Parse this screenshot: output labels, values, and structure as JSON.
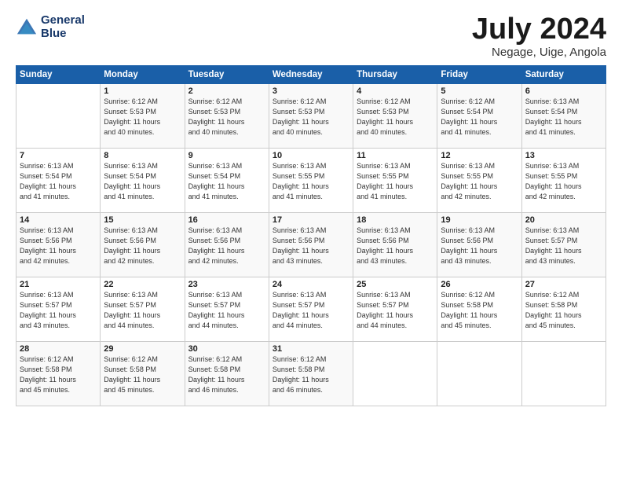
{
  "header": {
    "logo_line1": "General",
    "logo_line2": "Blue",
    "title": "July 2024",
    "location": "Negage, Uige, Angola"
  },
  "days_of_week": [
    "Sunday",
    "Monday",
    "Tuesday",
    "Wednesday",
    "Thursday",
    "Friday",
    "Saturday"
  ],
  "weeks": [
    [
      {
        "day": "",
        "info": ""
      },
      {
        "day": "1",
        "info": "Sunrise: 6:12 AM\nSunset: 5:53 PM\nDaylight: 11 hours\nand 40 minutes."
      },
      {
        "day": "2",
        "info": "Sunrise: 6:12 AM\nSunset: 5:53 PM\nDaylight: 11 hours\nand 40 minutes."
      },
      {
        "day": "3",
        "info": "Sunrise: 6:12 AM\nSunset: 5:53 PM\nDaylight: 11 hours\nand 40 minutes."
      },
      {
        "day": "4",
        "info": "Sunrise: 6:12 AM\nSunset: 5:53 PM\nDaylight: 11 hours\nand 40 minutes."
      },
      {
        "day": "5",
        "info": "Sunrise: 6:12 AM\nSunset: 5:54 PM\nDaylight: 11 hours\nand 41 minutes."
      },
      {
        "day": "6",
        "info": "Sunrise: 6:13 AM\nSunset: 5:54 PM\nDaylight: 11 hours\nand 41 minutes."
      }
    ],
    [
      {
        "day": "7",
        "info": "Sunrise: 6:13 AM\nSunset: 5:54 PM\nDaylight: 11 hours\nand 41 minutes."
      },
      {
        "day": "8",
        "info": "Sunrise: 6:13 AM\nSunset: 5:54 PM\nDaylight: 11 hours\nand 41 minutes."
      },
      {
        "day": "9",
        "info": "Sunrise: 6:13 AM\nSunset: 5:54 PM\nDaylight: 11 hours\nand 41 minutes."
      },
      {
        "day": "10",
        "info": "Sunrise: 6:13 AM\nSunset: 5:55 PM\nDaylight: 11 hours\nand 41 minutes."
      },
      {
        "day": "11",
        "info": "Sunrise: 6:13 AM\nSunset: 5:55 PM\nDaylight: 11 hours\nand 41 minutes."
      },
      {
        "day": "12",
        "info": "Sunrise: 6:13 AM\nSunset: 5:55 PM\nDaylight: 11 hours\nand 42 minutes."
      },
      {
        "day": "13",
        "info": "Sunrise: 6:13 AM\nSunset: 5:55 PM\nDaylight: 11 hours\nand 42 minutes."
      }
    ],
    [
      {
        "day": "14",
        "info": "Sunrise: 6:13 AM\nSunset: 5:56 PM\nDaylight: 11 hours\nand 42 minutes."
      },
      {
        "day": "15",
        "info": "Sunrise: 6:13 AM\nSunset: 5:56 PM\nDaylight: 11 hours\nand 42 minutes."
      },
      {
        "day": "16",
        "info": "Sunrise: 6:13 AM\nSunset: 5:56 PM\nDaylight: 11 hours\nand 42 minutes."
      },
      {
        "day": "17",
        "info": "Sunrise: 6:13 AM\nSunset: 5:56 PM\nDaylight: 11 hours\nand 43 minutes."
      },
      {
        "day": "18",
        "info": "Sunrise: 6:13 AM\nSunset: 5:56 PM\nDaylight: 11 hours\nand 43 minutes."
      },
      {
        "day": "19",
        "info": "Sunrise: 6:13 AM\nSunset: 5:56 PM\nDaylight: 11 hours\nand 43 minutes."
      },
      {
        "day": "20",
        "info": "Sunrise: 6:13 AM\nSunset: 5:57 PM\nDaylight: 11 hours\nand 43 minutes."
      }
    ],
    [
      {
        "day": "21",
        "info": "Sunrise: 6:13 AM\nSunset: 5:57 PM\nDaylight: 11 hours\nand 43 minutes."
      },
      {
        "day": "22",
        "info": "Sunrise: 6:13 AM\nSunset: 5:57 PM\nDaylight: 11 hours\nand 44 minutes."
      },
      {
        "day": "23",
        "info": "Sunrise: 6:13 AM\nSunset: 5:57 PM\nDaylight: 11 hours\nand 44 minutes."
      },
      {
        "day": "24",
        "info": "Sunrise: 6:13 AM\nSunset: 5:57 PM\nDaylight: 11 hours\nand 44 minutes."
      },
      {
        "day": "25",
        "info": "Sunrise: 6:13 AM\nSunset: 5:57 PM\nDaylight: 11 hours\nand 44 minutes."
      },
      {
        "day": "26",
        "info": "Sunrise: 6:12 AM\nSunset: 5:58 PM\nDaylight: 11 hours\nand 45 minutes."
      },
      {
        "day": "27",
        "info": "Sunrise: 6:12 AM\nSunset: 5:58 PM\nDaylight: 11 hours\nand 45 minutes."
      }
    ],
    [
      {
        "day": "28",
        "info": "Sunrise: 6:12 AM\nSunset: 5:58 PM\nDaylight: 11 hours\nand 45 minutes."
      },
      {
        "day": "29",
        "info": "Sunrise: 6:12 AM\nSunset: 5:58 PM\nDaylight: 11 hours\nand 45 minutes."
      },
      {
        "day": "30",
        "info": "Sunrise: 6:12 AM\nSunset: 5:58 PM\nDaylight: 11 hours\nand 46 minutes."
      },
      {
        "day": "31",
        "info": "Sunrise: 6:12 AM\nSunset: 5:58 PM\nDaylight: 11 hours\nand 46 minutes."
      },
      {
        "day": "",
        "info": ""
      },
      {
        "day": "",
        "info": ""
      },
      {
        "day": "",
        "info": ""
      }
    ]
  ]
}
